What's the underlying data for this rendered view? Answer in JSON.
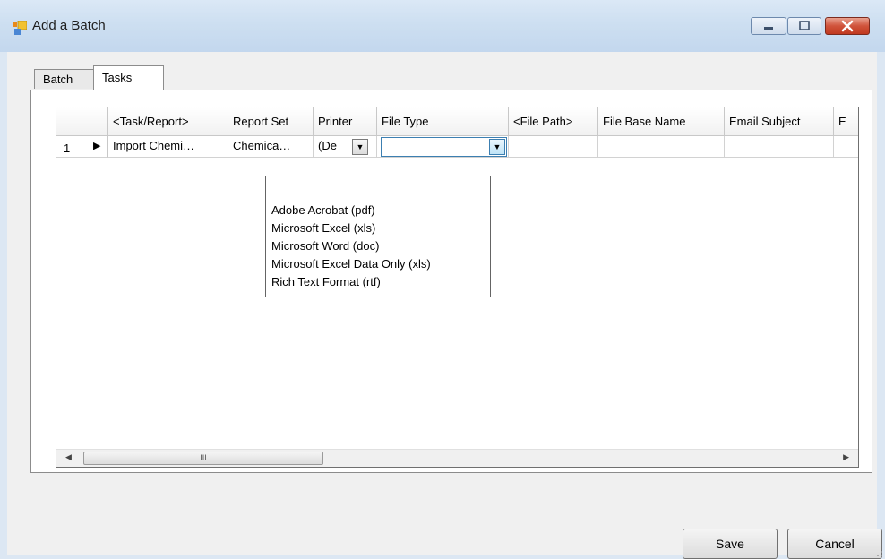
{
  "window": {
    "title": "Add a Batch"
  },
  "tabs": [
    {
      "label": "Batch",
      "active": false
    },
    {
      "label": "Tasks",
      "active": true
    }
  ],
  "grid": {
    "columns": [
      "<Task/Report>",
      "Report Set",
      "Printer",
      "File Type",
      "<File Path>",
      "File Base Name",
      "Email Subject",
      "E"
    ],
    "rows": [
      {
        "number": "1",
        "task": "Import Chemi…",
        "report_set": "Chemica…",
        "printer": "(De",
        "file_type": "",
        "file_path": "",
        "file_base_name": "",
        "email_subject": ""
      }
    ]
  },
  "file_type_options": [
    "",
    "Adobe Acrobat (pdf)",
    "Microsoft Excel (xls)",
    "Microsoft Word (doc)",
    "Microsoft Excel Data Only (xls)",
    "Rich Text Format (rtf)"
  ],
  "scrollbar": {
    "thumb_grip": "III"
  },
  "buttons": {
    "save": "Save",
    "cancel": "Cancel"
  },
  "icons": {
    "app": "app-window-icon",
    "minimize": "minimize-icon",
    "maximize": "maximize-icon",
    "close": "close-icon"
  },
  "colors": {
    "close_button": "#c0381f",
    "combo_focus": "#3c7fb1"
  }
}
